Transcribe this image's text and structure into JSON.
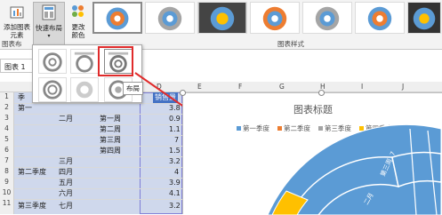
{
  "ribbon": {
    "add_chart_element": "添加图表\n元素",
    "quick_layout": "快速布局",
    "change_color": "更改\n颜色",
    "group_chart_layouts": "图表布",
    "group_chart_styles": "图表样式"
  },
  "namebox": {
    "value": "图表 1"
  },
  "columns": [
    "D",
    "E",
    "F",
    "G",
    "H",
    "I",
    "J"
  ],
  "rows": [
    "1",
    "2",
    "3",
    "4",
    "5",
    "6",
    "7",
    "8",
    "9",
    "10",
    "11"
  ],
  "table": {
    "header_a": "季",
    "header_d": "销售量",
    "rows": [
      {
        "a": "第一",
        "b": "",
        "c": "",
        "d": "3.8"
      },
      {
        "a": "",
        "b": "二月",
        "c": "第一周",
        "d": "0.9"
      },
      {
        "a": "",
        "b": "",
        "c": "第二周",
        "d": "1.1"
      },
      {
        "a": "",
        "b": "",
        "c": "第三周",
        "d": "7"
      },
      {
        "a": "",
        "b": "",
        "c": "第四周",
        "d": "1.5"
      },
      {
        "a": "",
        "b": "三月",
        "c": "",
        "d": "3.2"
      },
      {
        "a": "第二季度",
        "b": "四月",
        "c": "",
        "d": "4"
      },
      {
        "a": "",
        "b": "五月",
        "c": "",
        "d": "3.9"
      },
      {
        "a": "",
        "b": "六月",
        "c": "",
        "d": "4.1"
      },
      {
        "a": "第三季度",
        "b": "七月",
        "c": "",
        "d": "3.2"
      }
    ]
  },
  "tooltip": "布局",
  "chart": {
    "title": "图表标题",
    "legend": [
      {
        "label": "第一季度",
        "color": "#5b9bd5"
      },
      {
        "label": "第二季度",
        "color": "#ed7d31"
      },
      {
        "label": "第三季度",
        "color": "#a5a5a5"
      },
      {
        "label": "第四季度",
        "color": "#ffc000"
      }
    ],
    "segment_labels": [
      "第三周, 7",
      "二月"
    ]
  },
  "colors": {
    "accent_red": "#e02b2b",
    "selection": "#cfd8ec"
  }
}
